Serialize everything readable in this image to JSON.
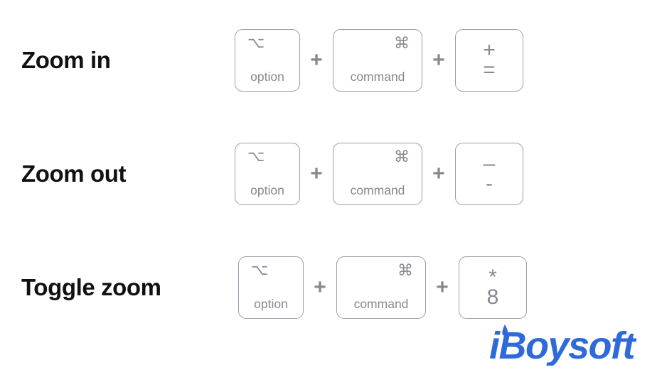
{
  "page": {
    "background": "#ffffff",
    "label_color": "#111111",
    "key_border_color": "#9a9ea6",
    "key_text_color": "#86898f",
    "brand_color": "#2f6bd8"
  },
  "separator": {
    "plus": "+",
    "icon": "plus-icon"
  },
  "shortcuts": [
    {
      "label": "Zoom in",
      "keys": [
        {
          "icon": "option-key-icon",
          "glyph": "⌥",
          "caption": "option"
        },
        {
          "icon": "command-key-icon",
          "glyph": "⌘",
          "caption": "command"
        },
        {
          "icon": "plus-equals-key-icon",
          "glyph": "+",
          "caption": "="
        }
      ]
    },
    {
      "label": "Zoom out",
      "keys": [
        {
          "icon": "option-key-icon",
          "glyph": "⌥",
          "caption": "option"
        },
        {
          "icon": "command-key-icon",
          "glyph": "⌘",
          "caption": "command"
        },
        {
          "icon": "underscore-hyphen-key-icon",
          "glyph": "–",
          "caption": "-"
        }
      ]
    },
    {
      "label": "Toggle zoom",
      "keys": [
        {
          "icon": "option-key-icon",
          "glyph": "⌥",
          "caption": "option"
        },
        {
          "icon": "command-key-icon",
          "glyph": "⌘",
          "caption": "command"
        },
        {
          "icon": "asterisk-eight-key-icon",
          "glyph": "*",
          "caption": "8"
        }
      ]
    }
  ],
  "logo": {
    "name": "iboysoft-logo",
    "text": "iBoysoft",
    "color": "#2f6bd8"
  }
}
